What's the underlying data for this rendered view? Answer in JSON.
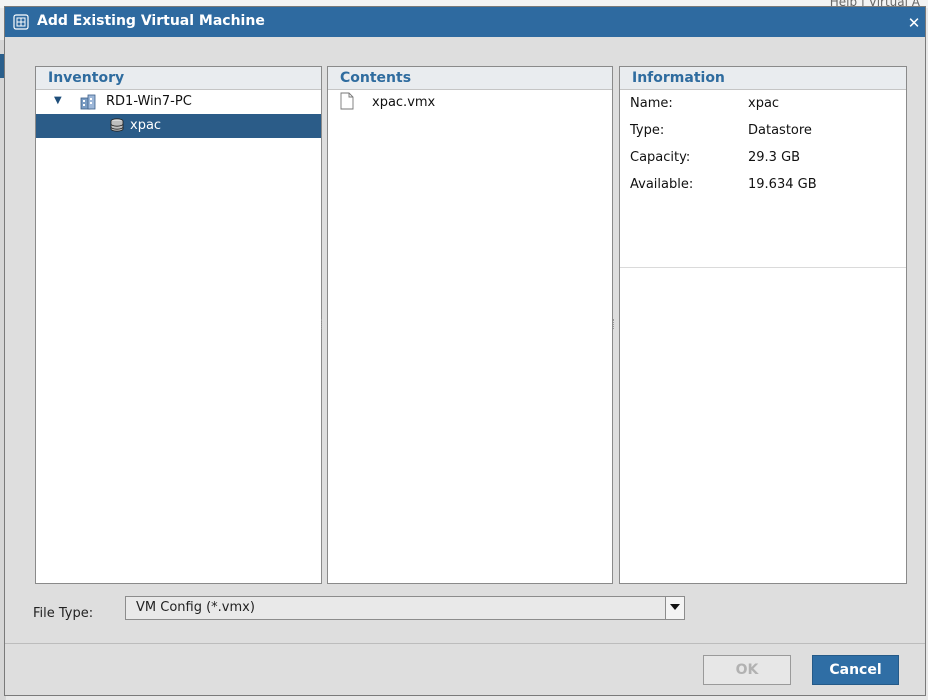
{
  "dialog": {
    "title": "Add Existing Virtual Machine",
    "close_icon": "close-icon",
    "title_icon": "vm-add-icon"
  },
  "background": {
    "menu_text": "Help  |  Virtual A"
  },
  "inventory": {
    "header": "Inventory",
    "items": [
      {
        "label": "RD1-Win7-PC",
        "icon": "host-icon",
        "expanded": true,
        "selected": false
      },
      {
        "label": "xpac",
        "icon": "datastore-icon",
        "selected": true
      }
    ]
  },
  "contents": {
    "header": "Contents",
    "files": [
      {
        "label": "xpac.vmx",
        "icon": "file-icon"
      }
    ]
  },
  "information": {
    "header": "Information",
    "rows": [
      {
        "label": "Name:",
        "value": "xpac"
      },
      {
        "label": "Type:",
        "value": "Datastore"
      },
      {
        "label": "Capacity:",
        "value": "29.3 GB"
      },
      {
        "label": "Available:",
        "value": "19.634 GB"
      }
    ]
  },
  "file_type": {
    "label": "File Type:",
    "selected": "VM Config (*.vmx)"
  },
  "buttons": {
    "ok": "OK",
    "cancel": "Cancel"
  },
  "colors": {
    "titlebar": "#2e6aa0",
    "selected_row": "#2b5c88",
    "header_text": "#2f6c9f",
    "primary_button": "#2f6ea5"
  }
}
